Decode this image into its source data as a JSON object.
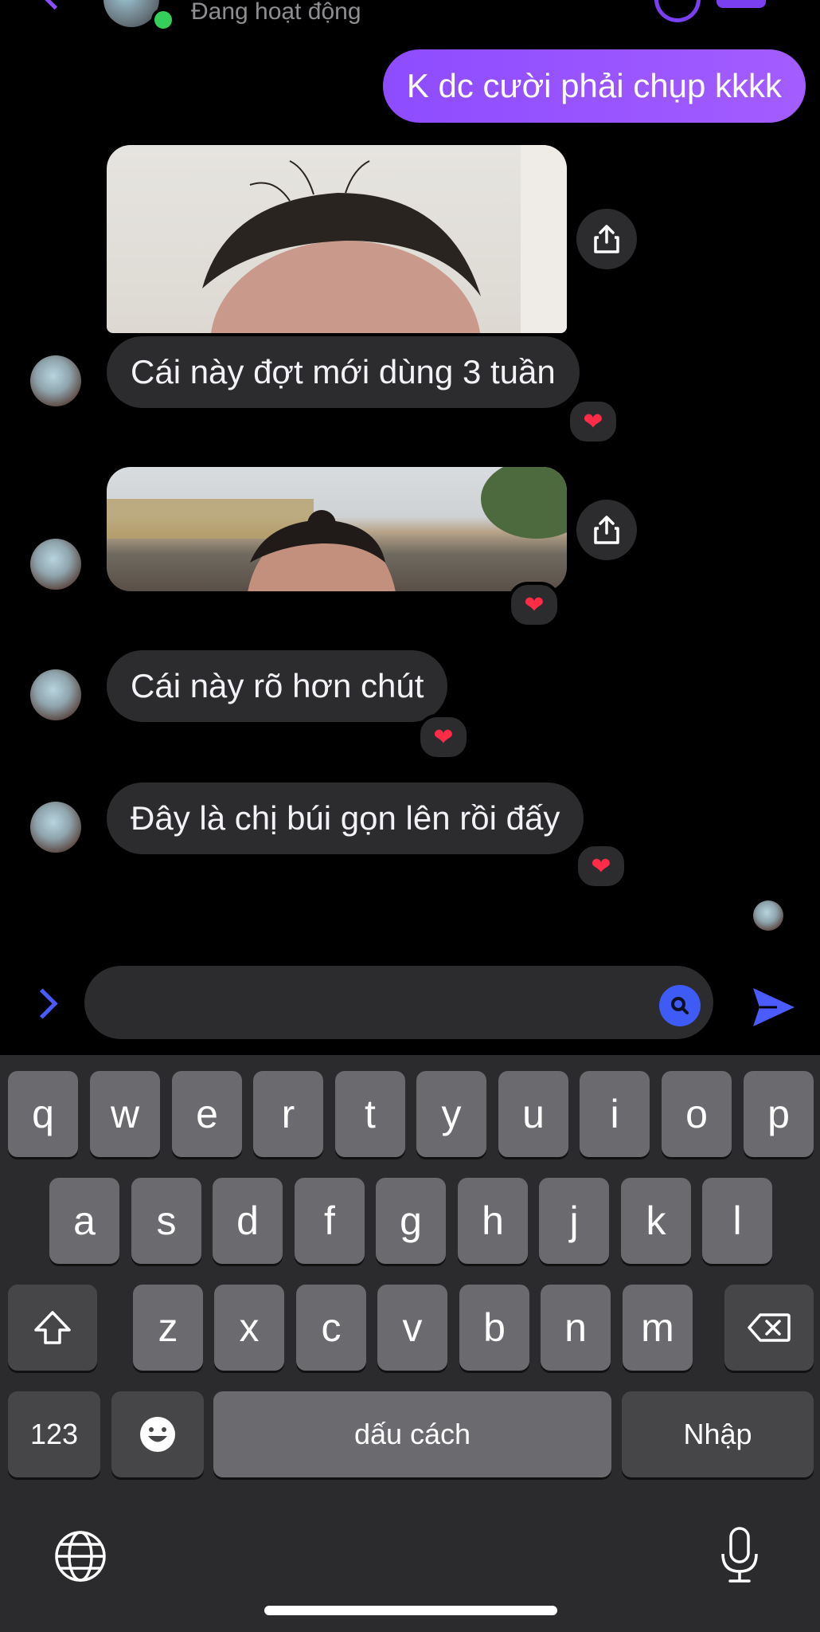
{
  "header": {
    "status": "Đang hoạt động"
  },
  "messages": {
    "sent_1": "K dc cười phải chụp kkkk",
    "received_1": "Cái này đợt mới dùng 3 tuần",
    "received_2": "Cái này rõ hơn chút",
    "received_3": "Đây là chị búi gọn lên rồi đấy",
    "reaction": "❤"
  },
  "input": {
    "value": "",
    "placeholder": ""
  },
  "keyboard": {
    "row1": [
      "q",
      "w",
      "e",
      "r",
      "t",
      "y",
      "u",
      "i",
      "o",
      "p"
    ],
    "row2": [
      "a",
      "s",
      "d",
      "f",
      "g",
      "h",
      "j",
      "k",
      "l"
    ],
    "row3": [
      "z",
      "x",
      "c",
      "v",
      "b",
      "n",
      "m"
    ],
    "numbers_key": "123",
    "space_key": "dấu cách",
    "return_key": "Nhập"
  },
  "colors": {
    "accent": "#8d4cff",
    "bubble_gray": "#2c2c2e",
    "send_blue": "#3f5bf5",
    "heart": "#ff2b47"
  },
  "icons": [
    "back-chevron-icon",
    "phone-icon",
    "video-icon",
    "share-icon",
    "heart-icon",
    "chevron-right-icon",
    "search-icon",
    "send-icon",
    "shift-icon",
    "backspace-icon",
    "emoji-icon",
    "globe-icon",
    "microphone-icon"
  ]
}
